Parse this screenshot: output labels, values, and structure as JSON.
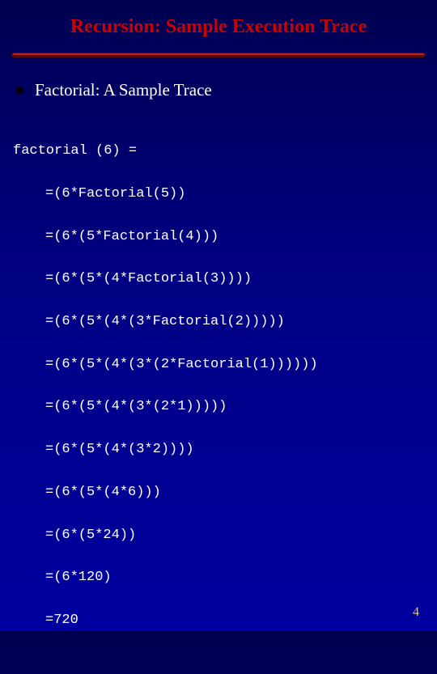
{
  "title": "Recursion: Sample Execution Trace",
  "bullet": "Factorial: A Sample Trace",
  "code": {
    "head": "factorial (6) =",
    "lines": [
      "=(6*Factorial(5))",
      "=(6*(5*Factorial(4)))",
      "=(6*(5*(4*Factorial(3))))",
      "=(6*(5*(4*(3*Factorial(2)))))",
      "=(6*(5*(4*(3*(2*Factorial(1))))))",
      "=(6*(5*(4*(3*(2*1)))))",
      "=(6*(5*(4*(3*2))))",
      "=(6*(5*(4*6)))",
      "=(6*(5*24))",
      "=(6*120)",
      "=720"
    ]
  },
  "page_number": "4"
}
